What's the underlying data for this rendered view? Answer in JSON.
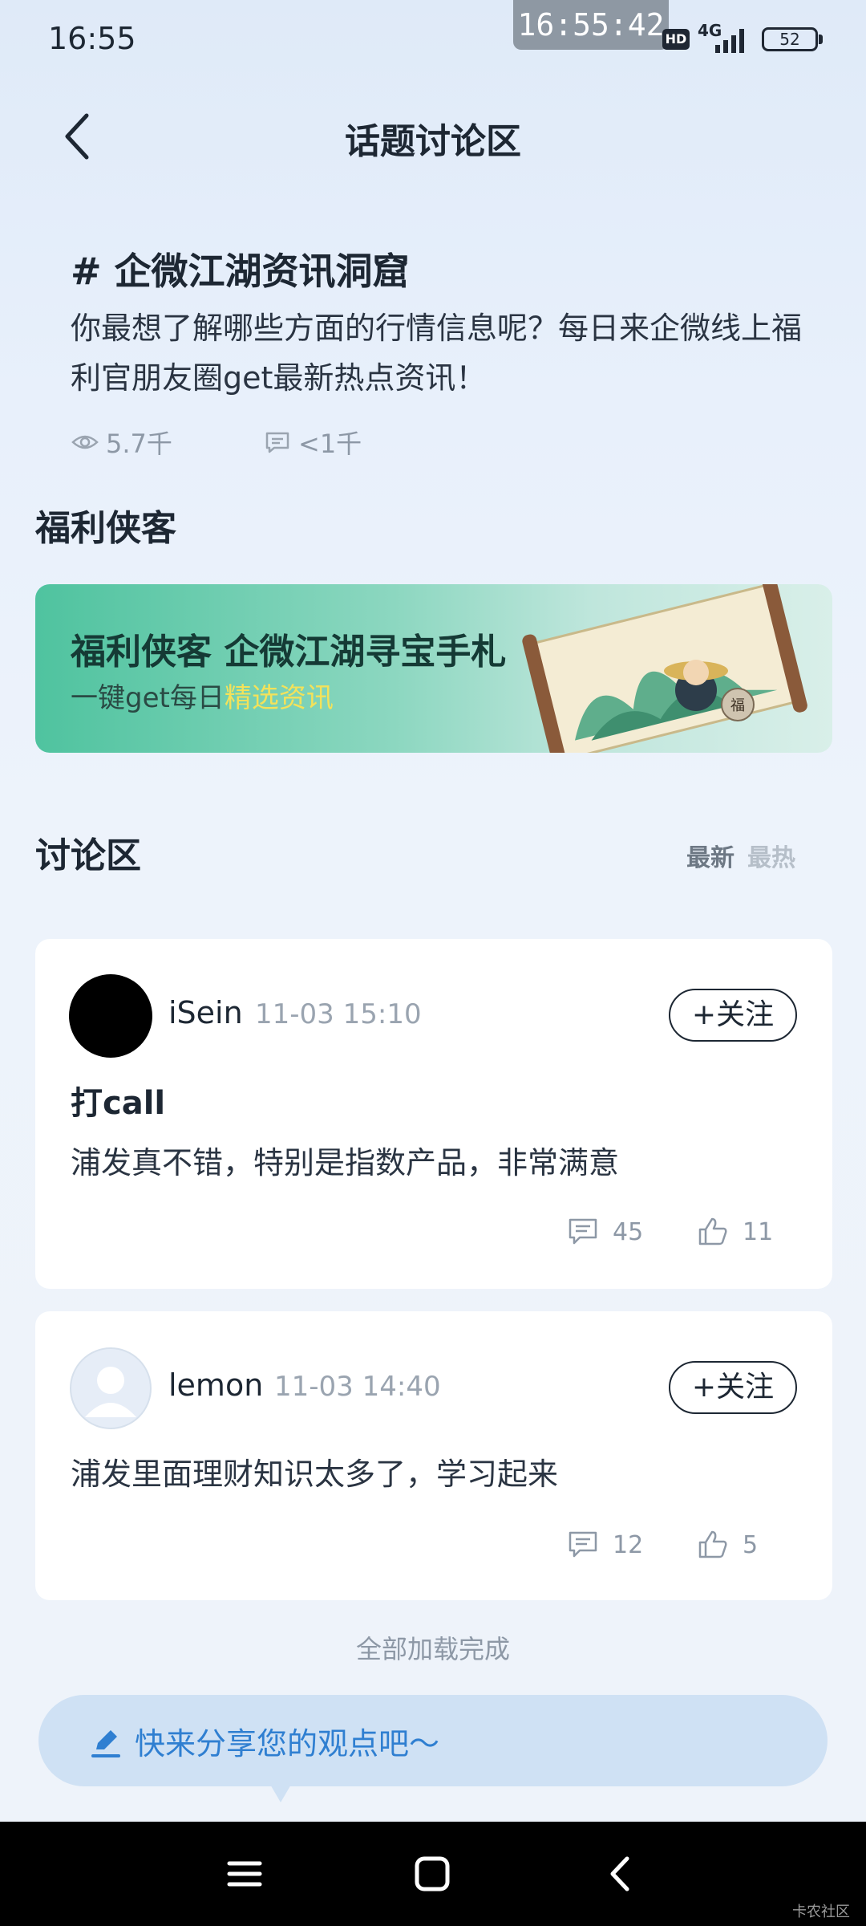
{
  "status_bar": {
    "time": "16:55",
    "overlay_time": "16:55:42",
    "hd": "HD",
    "network": "4G",
    "battery": "52"
  },
  "header": {
    "title": "话题讨论区"
  },
  "topic": {
    "title": "# 企微江湖资讯洞窟",
    "description": "你最想了解哪些方面的行情信息呢？每日来企微线上福利官朋友圈get最新热点资讯！",
    "views": "5.7千",
    "comments": "<1千"
  },
  "section_promo": {
    "title": "福利侠客"
  },
  "banner": {
    "title": "福利侠客 企微江湖寻宝手札",
    "subtitle_prefix": "一键get每日",
    "subtitle_highlight": "精选资讯",
    "seal_char": "福"
  },
  "discussion": {
    "title": "讨论区",
    "sort_newest": "最新",
    "sort_hottest": "最热"
  },
  "posts": [
    {
      "user": "iSein",
      "time": "11-03 15:10",
      "follow": "+关注",
      "title": "打call",
      "body": "浦发真不错，特别是指数产品，非常满意",
      "comments": "45",
      "likes": "11"
    },
    {
      "user": "lemon",
      "time": "11-03 14:40",
      "follow": "+关注",
      "body": "浦发里面理财知识太多了，学习起来",
      "comments": "12",
      "likes": "5"
    }
  ],
  "footer": {
    "loaded_text": "全部加载完成",
    "share_placeholder": "快来分享您的观点吧～"
  },
  "watermark": "卡农社区",
  "colors": {
    "accent": "#2f7fd1",
    "background": "#e8f0fb",
    "share_bar": "#cfe1f4"
  }
}
